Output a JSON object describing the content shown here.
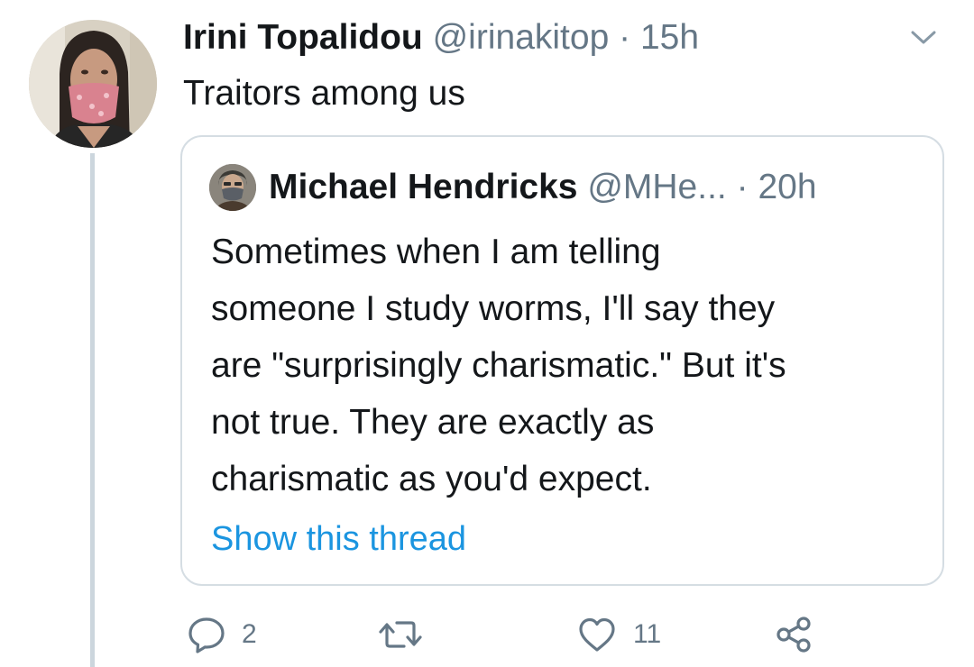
{
  "tweet": {
    "author_name": "Irini Topalidou",
    "handle": "@irinakitop",
    "separator": "·",
    "time": "15h",
    "text": "Traitors among us"
  },
  "quoted_tweet": {
    "author_name": "Michael Hendricks",
    "handle": "@MHe...",
    "separator": "·",
    "time": "20h",
    "text_lines": [
      "Sometimes when I am telling",
      "someone I study worms, I'll say they",
      "are \"surprisingly charismatic.\" But it's",
      "not true. They are exactly as",
      "charismatic as you'd expect."
    ],
    "show_thread_label": "Show this thread"
  },
  "actions": {
    "reply_count": "2",
    "retweet_count": "",
    "like_count": "11"
  },
  "icons": {
    "menu": "chevron-down-icon",
    "reply": "reply-icon",
    "retweet": "retweet-icon",
    "like": "heart-icon",
    "share": "share-icon"
  },
  "colors": {
    "link": "#1b95e0",
    "muted_text": "#657786",
    "primary_text": "#14171a",
    "thread_line": "#ccd6dd",
    "card_border": "#d5dde3"
  }
}
